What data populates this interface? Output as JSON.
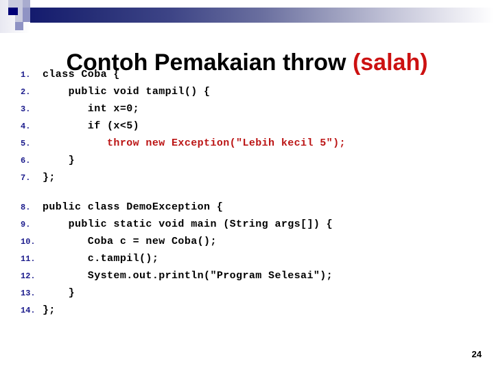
{
  "slide": {
    "title_main": "Contoh Pemakaian throw ",
    "title_accent": "(salah)",
    "page_number": "24"
  },
  "theme": {
    "accent_red": "#cc1111",
    "code_error_red": "#bb1414",
    "line_number_blue": "#1b1b8c",
    "band_navy": "#141b6e"
  },
  "code": {
    "lines": [
      {
        "n": "1.",
        "text": "class Coba {",
        "error": false
      },
      {
        "n": "2.",
        "text": "    public void tampil() {",
        "error": false
      },
      {
        "n": "3.",
        "text": "       int x=0;",
        "error": false
      },
      {
        "n": "4.",
        "text": "       if (x<5)",
        "error": false
      },
      {
        "n": "5.",
        "text": "          throw new Exception(\"Lebih kecil 5\");",
        "error": true
      },
      {
        "n": "6.",
        "text": "    }",
        "error": false
      },
      {
        "n": "7.",
        "text": "};",
        "error": false
      },
      {
        "n": "",
        "text": "",
        "error": false
      },
      {
        "n": "8.",
        "text": "public class DemoException {",
        "error": false
      },
      {
        "n": "9.",
        "text": "    public static void main (String args[]) {",
        "error": false
      },
      {
        "n": "10.",
        "text": "       Coba c = new Coba();",
        "error": false
      },
      {
        "n": "11.",
        "text": "       c.tampil();",
        "error": false
      },
      {
        "n": "12.",
        "text": "       System.out.println(\"Program Selesai\");",
        "error": false
      },
      {
        "n": "13.",
        "text": "    }",
        "error": false
      },
      {
        "n": "14.",
        "text": "};",
        "error": false
      }
    ]
  }
}
